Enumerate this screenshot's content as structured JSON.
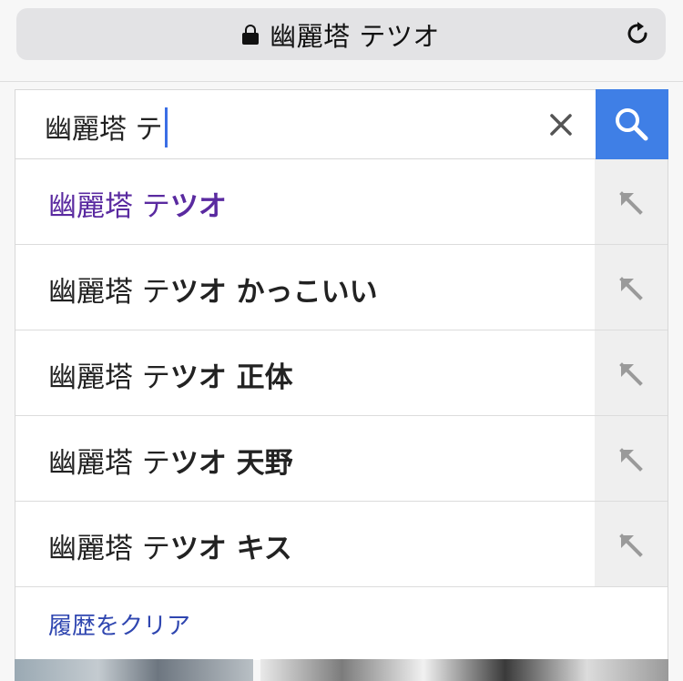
{
  "browser": {
    "url_text": "幽麗塔 テツオ",
    "lock_icon": "lock-icon",
    "reload_icon": "reload-icon"
  },
  "search": {
    "value": "幽麗塔 テ",
    "clear_icon": "close-icon",
    "submit_icon": "search-icon",
    "accent_color": "#3f7fe6"
  },
  "suggestions": [
    {
      "typed": "幽麗塔 テ",
      "rest": "ツオ",
      "visited": true
    },
    {
      "typed": "幽麗塔 テ",
      "rest": "ツオ かっこいい",
      "visited": false
    },
    {
      "typed": "幽麗塔 テ",
      "rest": "ツオ 正体",
      "visited": false
    },
    {
      "typed": "幽麗塔 テ",
      "rest": "ツオ 天野",
      "visited": false
    },
    {
      "typed": "幽麗塔 テ",
      "rest": "ツオ キス",
      "visited": false
    }
  ],
  "clear_history_label": "履歴をクリア",
  "colors": {
    "visited_link": "#5a2aa0",
    "clear_history_link": "#2f46b0"
  }
}
